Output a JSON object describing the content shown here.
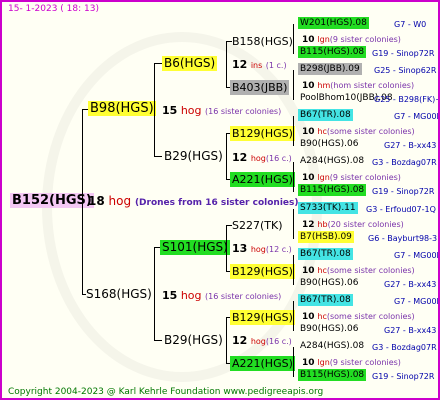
{
  "header": "15-   1-2023  (  18:  13)",
  "footer": "Copyright 2004-2023 @ Karl Kehrle Foundation    www.pedigreeapis.org",
  "root": {
    "name": "B152(HGS)",
    "count": "18",
    "hog": "hog",
    "note": "(Drones from 16 sister colonies)"
  },
  "g1": [
    {
      "name": "B98(HGS)",
      "count": "15",
      "hog": "hog",
      "note": "(16 sister colonies)"
    },
    {
      "name": "S168(HGS)",
      "count": "15",
      "hog": "hog",
      "note": "(16 sister colonies)"
    }
  ],
  "g2": [
    {
      "name": "B6(HGS)",
      "count": "12",
      "hog": "ins",
      "note": "(1 c.)"
    },
    {
      "name": "B29(HGS)",
      "count": "12",
      "hog": "hog",
      "note": "(16 c.)"
    },
    {
      "name": "S101(HGS)",
      "count": "13",
      "hog": "hog",
      "note": "(12 c.)"
    },
    {
      "name": "B29(HGS)",
      "count": "12",
      "hog": "hog",
      "note": "(16 c.)"
    }
  ],
  "g3": [
    {
      "name": "B158(HGS)"
    },
    {
      "name": "B403(JBB)"
    },
    {
      "name": "B129(HGS)"
    },
    {
      "name": "A221(HGS)"
    },
    {
      "name": "S227(TK)"
    },
    {
      "name": "B129(HGS)"
    },
    {
      "name": "B129(HGS)"
    },
    {
      "name": "A221(HGS)"
    }
  ],
  "g4": [
    {
      "a": "W201(HGS).08",
      "ai": "G7 - W0",
      "n": "10",
      "h": "lgn",
      "s": "(9 sister colonies)",
      "b": "B115(HGS).08",
      "bi": "G19 - Sinop72R"
    },
    {
      "a": "B298(JBB).09",
      "ai": "G25 - Sinop62R",
      "n": "10",
      "h": "hm",
      "s": "(hom sister colonies)",
      "b": "PoolBhom10(JBB).08",
      "bi": "G25 - B298(FK)+3"
    },
    {
      "a": "B67(TR).08",
      "ai": "G7 - MG00R",
      "n": "10",
      "h": "hc",
      "s": "(some sister colonies)",
      "b": "B90(HGS).06",
      "bi": "G27 - B-xx43"
    },
    {
      "a": "A284(HGS).08",
      "ai": "G3 - Bozdag07R",
      "n": "10",
      "h": "lgn",
      "s": "(9 sister colonies)",
      "b": "B115(HGS).08",
      "bi": "G19 - Sinop72R"
    },
    {
      "a": "S733(TK).11",
      "ai": "G3 - Erfoud07-1Q",
      "n": "12",
      "h": "hb",
      "s": "(20 sister colonies)",
      "b": "B7(HSB).09",
      "bi": "G6 - Bayburt98-3"
    },
    {
      "a": "B67(TR).08",
      "ai": "G7 - MG00R",
      "n": "10",
      "h": "hc",
      "s": "(some sister colonies)",
      "b": "B90(HGS).06",
      "bi": "G27 - B-xx43"
    },
    {
      "a": "B67(TR).08",
      "ai": "G7 - MG00R",
      "n": "10",
      "h": "hc",
      "s": "(some sister colonies)",
      "b": "B90(HGS).06",
      "bi": "G27 - B-xx43"
    },
    {
      "a": "A284(HGS).08",
      "ai": "G3 - Bozdag07R",
      "n": "10",
      "h": "lgn",
      "s": "(9 sister colonies)",
      "b": "B115(HGS).08",
      "bi": "G19 - Sinop72R"
    }
  ]
}
